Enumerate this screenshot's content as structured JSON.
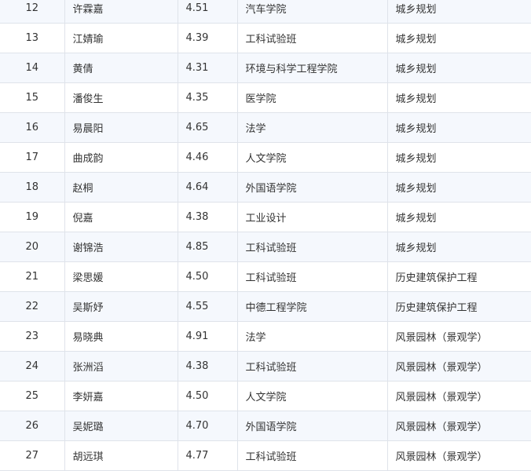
{
  "table": {
    "rows": [
      {
        "no": "12",
        "name": "许霖嘉",
        "score": "4.51",
        "college": "汽车学院",
        "major": "城乡规划"
      },
      {
        "no": "13",
        "name": "江婧瑜",
        "score": "4.39",
        "college": "工科试验班",
        "major": "城乡规划"
      },
      {
        "no": "14",
        "name": "黄倩",
        "score": "4.31",
        "college": "环境与科学工程学院",
        "major": "城乡规划"
      },
      {
        "no": "15",
        "name": "潘俊生",
        "score": "4.35",
        "college": "医学院",
        "major": "城乡规划"
      },
      {
        "no": "16",
        "name": "易晨阳",
        "score": "4.65",
        "college": "法学",
        "major": "城乡规划"
      },
      {
        "no": "17",
        "name": "曲成韵",
        "score": "4.46",
        "college": "人文学院",
        "major": "城乡规划"
      },
      {
        "no": "18",
        "name": "赵桐",
        "score": "4.64",
        "college": "外国语学院",
        "major": "城乡规划"
      },
      {
        "no": "19",
        "name": "倪嘉",
        "score": "4.38",
        "college": "工业设计",
        "major": "城乡规划"
      },
      {
        "no": "20",
        "name": "谢锦浩",
        "score": "4.85",
        "college": "工科试验班",
        "major": "城乡规划"
      },
      {
        "no": "21",
        "name": "梁思媛",
        "score": "4.50",
        "college": "工科试验班",
        "major": "历史建筑保护工程"
      },
      {
        "no": "22",
        "name": "吴斯妤",
        "score": "4.55",
        "college": "中德工程学院",
        "major": "历史建筑保护工程"
      },
      {
        "no": "23",
        "name": "易晓典",
        "score": "4.91",
        "college": "法学",
        "major": "风景园林（景观学）"
      },
      {
        "no": "24",
        "name": "张洲滔",
        "score": "4.38",
        "college": "工科试验班",
        "major": "风景园林（景观学）"
      },
      {
        "no": "25",
        "name": "李妍嘉",
        "score": "4.50",
        "college": "人文学院",
        "major": "风景园林（景观学）"
      },
      {
        "no": "26",
        "name": "吴妮璐",
        "score": "4.70",
        "college": "外国语学院",
        "major": "风景园林（景观学）"
      },
      {
        "no": "27",
        "name": "胡远琪",
        "score": "4.77",
        "college": "工科试验班",
        "major": "风景园林（景观学）"
      }
    ]
  }
}
